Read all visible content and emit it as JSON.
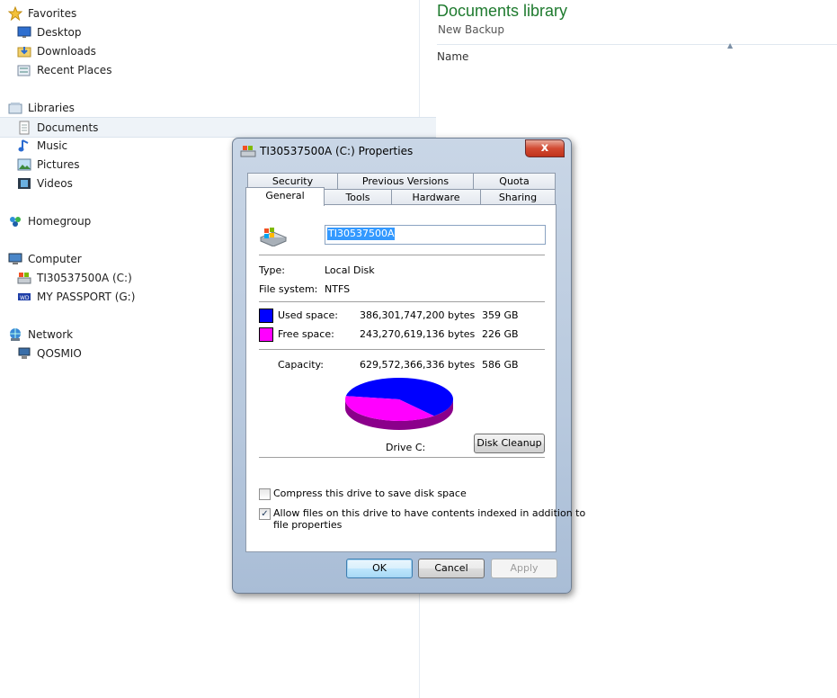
{
  "nav": {
    "favorites": "Favorites",
    "desktop": "Desktop",
    "downloads": "Downloads",
    "recent_places": "Recent Places",
    "libraries": "Libraries",
    "documents": "Documents",
    "music": "Music",
    "pictures": "Pictures",
    "videos": "Videos",
    "homegroup": "Homegroup",
    "computer": "Computer",
    "drive_c": "TI30537500A (C:)",
    "drive_g": "MY PASSPORT (G:)",
    "network": "Network",
    "qosmio": "QOSMIO"
  },
  "library": {
    "title": "Documents library",
    "subtitle": "New Backup",
    "column_name": "Name"
  },
  "dialog": {
    "title": "TI30537500A (C:) Properties",
    "close": "x",
    "tabs_row1": [
      "Security",
      "Previous Versions",
      "Quota"
    ],
    "tabs_row2": [
      "General",
      "Tools",
      "Hardware",
      "Sharing"
    ],
    "drive_name": "TI30537500A",
    "type_label": "Type:",
    "type_value": "Local Disk",
    "fs_label": "File system:",
    "fs_value": "NTFS",
    "used_label": "Used space:",
    "used_bytes": "386,301,747,200 bytes",
    "used_gb": "359 GB",
    "free_label": "Free space:",
    "free_bytes": "243,270,619,136 bytes",
    "free_gb": "226 GB",
    "capacity_label": "Capacity:",
    "capacity_bytes": "629,572,366,336 bytes",
    "capacity_gb": "586 GB",
    "drive_label": "Drive C:",
    "disk_cleanup": "Disk Cleanup",
    "compress_label": "Compress this drive to save disk space",
    "index_label_1": "Allow files on this drive to have contents indexed in addition to",
    "index_label_2": "file properties",
    "compress_checked": false,
    "index_checked": true,
    "ok": "OK",
    "cancel": "Cancel",
    "apply": "Apply",
    "used_color": "#0000ff",
    "free_color": "#ff00ff"
  },
  "chart_data": {
    "type": "pie",
    "categories": [
      "Used space",
      "Free space"
    ],
    "values": [
      359,
      226
    ],
    "colors": [
      "#0000ff",
      "#ff00ff"
    ]
  }
}
